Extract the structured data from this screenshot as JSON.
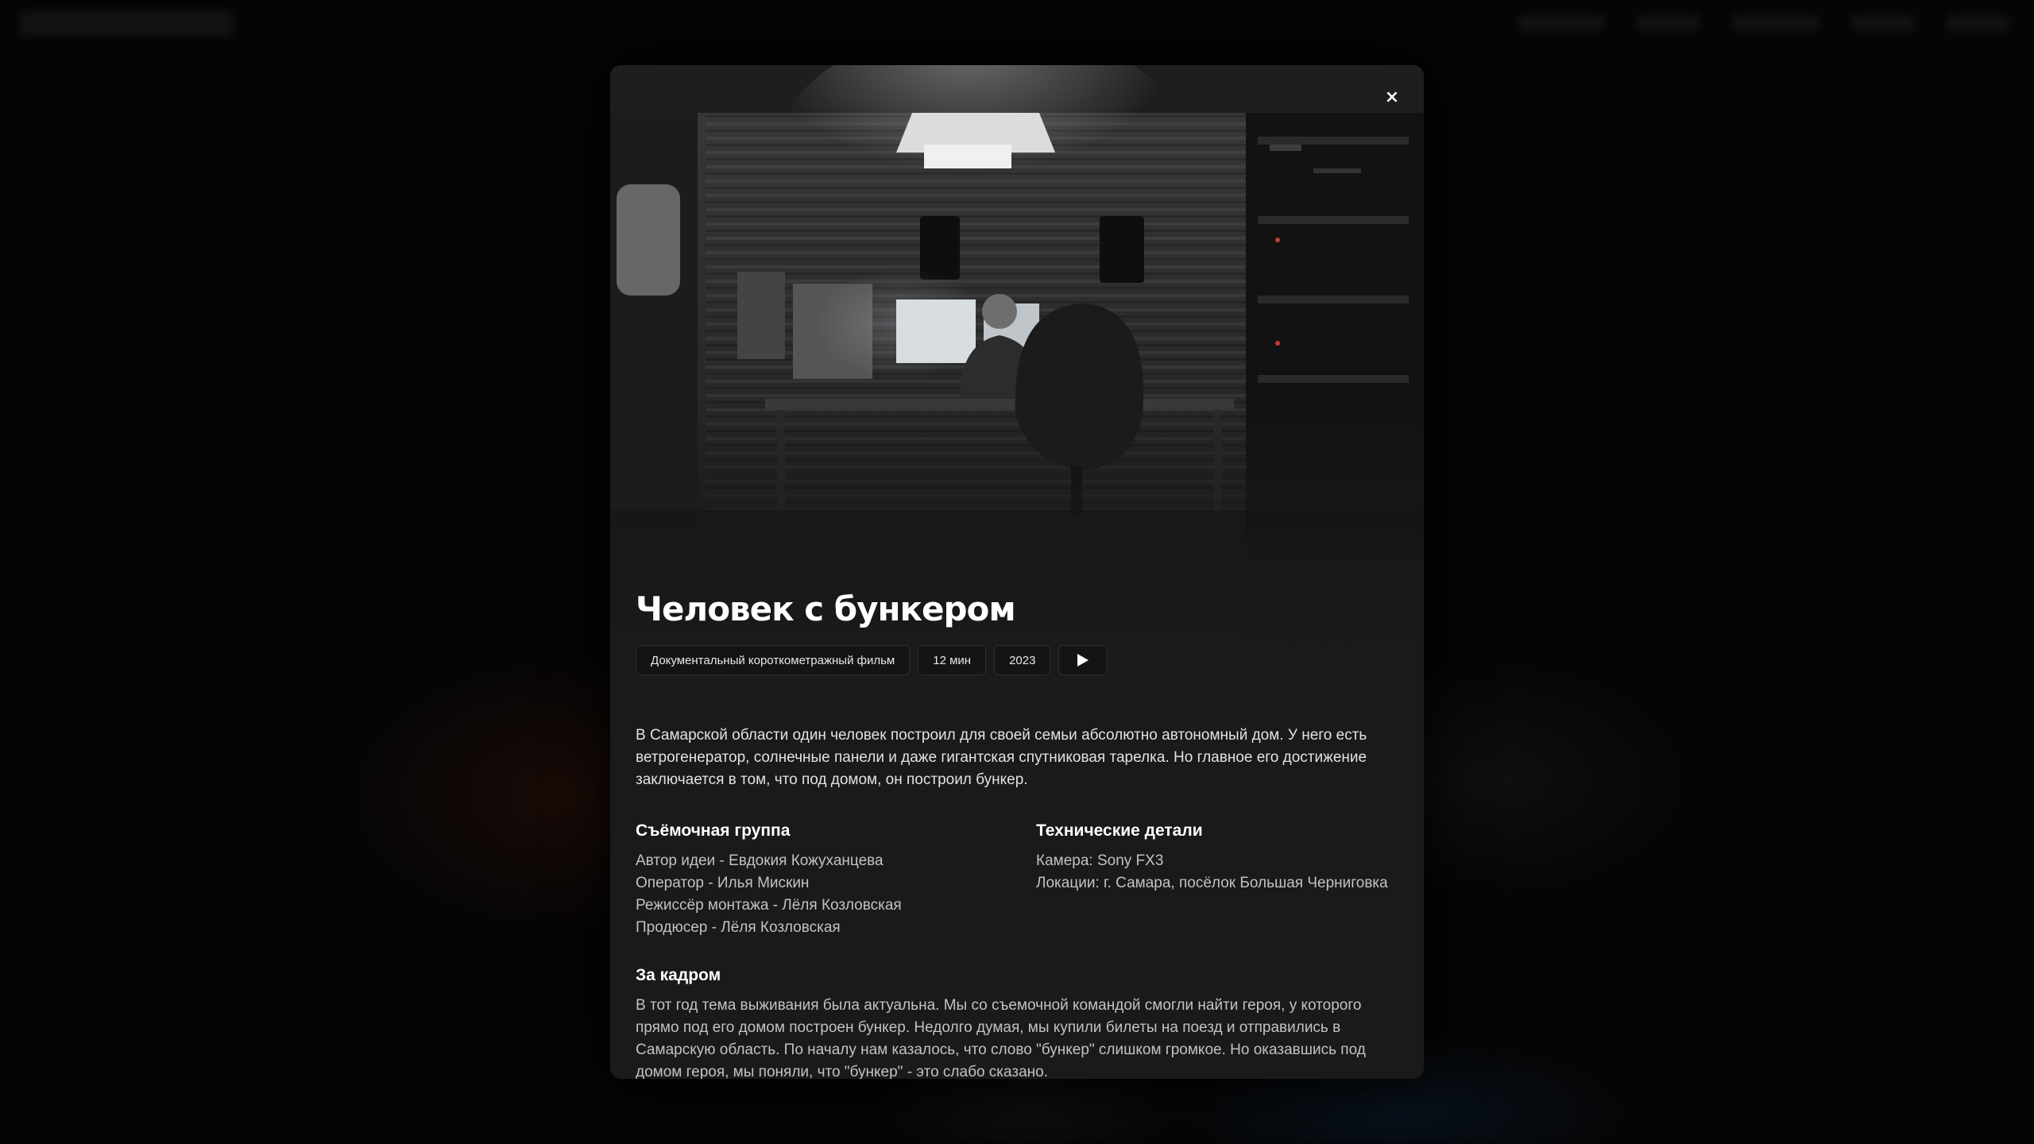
{
  "modal": {
    "close_label": "×",
    "title": "Человек с бункером",
    "tags": {
      "genre": "Документальный короткометражный фильм",
      "duration": "12 мин",
      "year": "2023"
    },
    "play_icon": "play-icon",
    "description": "В Самарской области один человек построил для своей семьи абсолютно автономный дом. У него есть ветрогенератор, солнечные панели и даже гигантская спутниковая тарелка. Но главное его достижение заключается в том, что под домом, он построил бункер.",
    "crew": {
      "heading": "Съёмочная группа",
      "lines": [
        "Автор идеи - Евдокия Кожуханцева",
        "Оператор - Илья Мискин",
        "Режиссёр монтажа - Лёля Козловская",
        "Продюсер - Лёля Козловская"
      ]
    },
    "tech": {
      "heading": "Технические детали",
      "lines": [
        "Камера: Sony FX3",
        "Локации: г. Самара, посёлок Большая Черниговка"
      ]
    },
    "behind": {
      "heading": "За кадром",
      "text": "В тот год тема выживания была актуальна. Мы со съемочной командой смогли найти героя, у которого прямо под его домом построен бункер. Недолго думая, мы купили билеты на поезд и отправились в Самарскую область. По началу нам казалось, что слово \"бункер\" слишком громкое. Но оказавшись под домом героя, мы поняли, что \"бункер\" - это слабо сказано."
    }
  },
  "colors": {
    "modal_bg": "#1a1a1a",
    "page_bg": "#050505",
    "text_primary": "#ffffff",
    "text_secondary": "#c2c2c2"
  }
}
